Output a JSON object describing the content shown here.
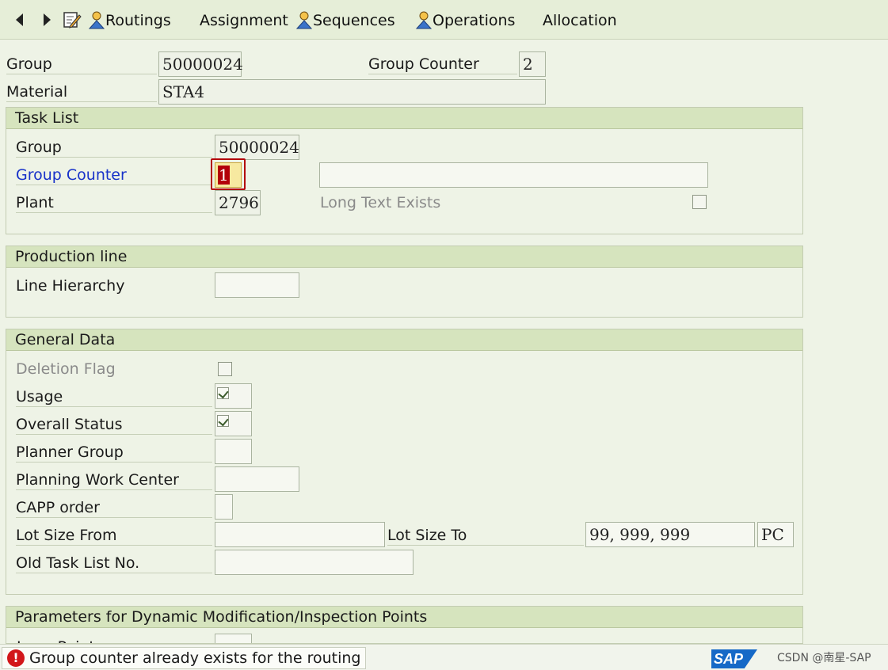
{
  "toolbar": {
    "routings": "Routings",
    "assignment": "Assignment",
    "sequences": "Sequences",
    "operations": "Operations",
    "allocation": "Allocation"
  },
  "header": {
    "group_label": "Group",
    "group_value": "50000024",
    "group_counter_label": "Group Counter",
    "group_counter_value": "2",
    "material_label": "Material",
    "material_value": "STA4"
  },
  "task_list": {
    "title": "Task List",
    "group_label": "Group",
    "group_value": "50000024",
    "group_counter_label": "Group Counter",
    "group_counter_value": "1",
    "description_value": "",
    "plant_label": "Plant",
    "plant_value": "2796",
    "long_text_label": "Long Text Exists"
  },
  "production_line": {
    "title": "Production line",
    "line_hierarchy_label": "Line Hierarchy",
    "line_hierarchy_value": ""
  },
  "general_data": {
    "title": "General Data",
    "deletion_flag_label": "Deletion Flag",
    "usage_label": "Usage",
    "overall_status_label": "Overall Status",
    "planner_group_label": "Planner Group",
    "planner_group_value": "",
    "planning_work_center_label": "Planning Work Center",
    "planning_work_center_value": "",
    "capp_order_label": "CAPP order",
    "capp_order_value": "",
    "lot_size_from_label": "Lot Size From",
    "lot_size_from_value": "",
    "lot_size_to_label": "Lot Size To",
    "lot_size_to_value": "99, 999, 999",
    "lot_size_unit": "PC",
    "old_task_list_label": "Old Task List No.",
    "old_task_list_value": ""
  },
  "dynamic_mod": {
    "title": "Parameters for Dynamic Modification/Inspection Points",
    "insp_points_label": "Insp. Points"
  },
  "status": {
    "message": "Group counter already exists for the routing",
    "error_symbol": "!",
    "logo_text": "SAP",
    "watermark": "CSDN @南星-SAP"
  },
  "colors": {
    "background": "#eef3e6",
    "section_header": "#d6e4be",
    "focus_field": "#f7e9a0",
    "error_border": "#b3000a",
    "link_label": "#1832c9"
  }
}
